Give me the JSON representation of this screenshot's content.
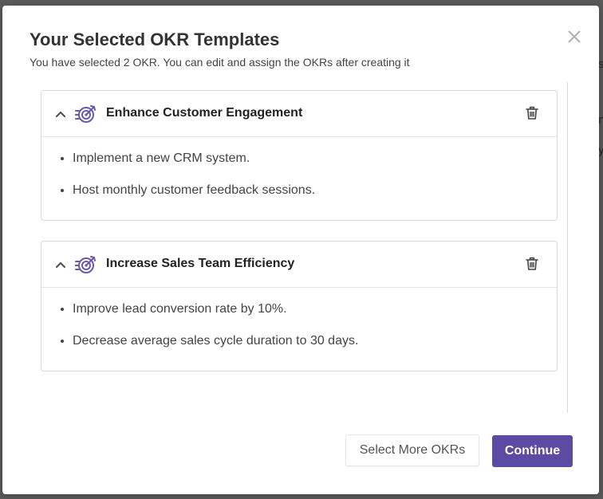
{
  "modal": {
    "title": "Your Selected OKR Templates",
    "subtitle": "You have selected 2 OKR. You can edit and assign the OKRs after creating it",
    "close_icon": "close-icon"
  },
  "okrs": [
    {
      "title": "Enhance Customer Engagement",
      "key_results": [
        "Implement a new CRM system.",
        "Host monthly customer feedback sessions."
      ]
    },
    {
      "title": "Increase Sales Team Efficiency",
      "key_results": [
        "Improve lead conversion rate by 10%.",
        "Decrease average sales cycle duration to 30 days."
      ]
    }
  ],
  "footer": {
    "select_more_label": "Select More OKRs",
    "continue_label": "Continue"
  },
  "colors": {
    "primary": "#5b4ba3",
    "icon_accent": "#6a5aa8"
  }
}
